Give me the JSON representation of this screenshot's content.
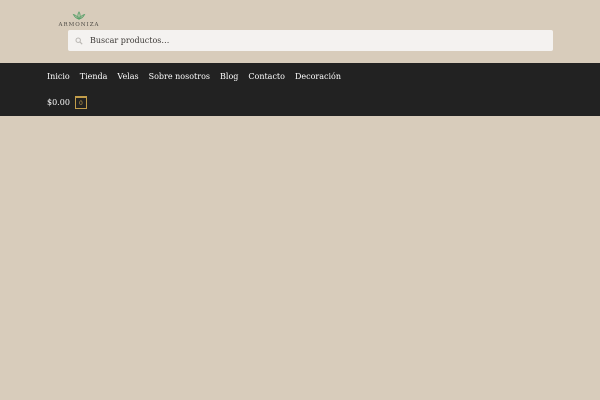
{
  "brand": {
    "logo_text": "ARMONIZA"
  },
  "search": {
    "placeholder": "Buscar productos…",
    "icon": "search-icon"
  },
  "nav": {
    "items": [
      {
        "label": "Inicio"
      },
      {
        "label": "Tienda"
      },
      {
        "label": "Velas"
      },
      {
        "label": "Sobre nosotros"
      },
      {
        "label": "Blog"
      },
      {
        "label": "Contacto"
      },
      {
        "label": "Decoración"
      }
    ]
  },
  "cart": {
    "amount": "$0.00",
    "count": "0"
  },
  "colors": {
    "page_background": "#d8ccbb",
    "navbar_background": "#222222",
    "accent": "#c29d4a",
    "logo_green": "#5aa06a"
  }
}
